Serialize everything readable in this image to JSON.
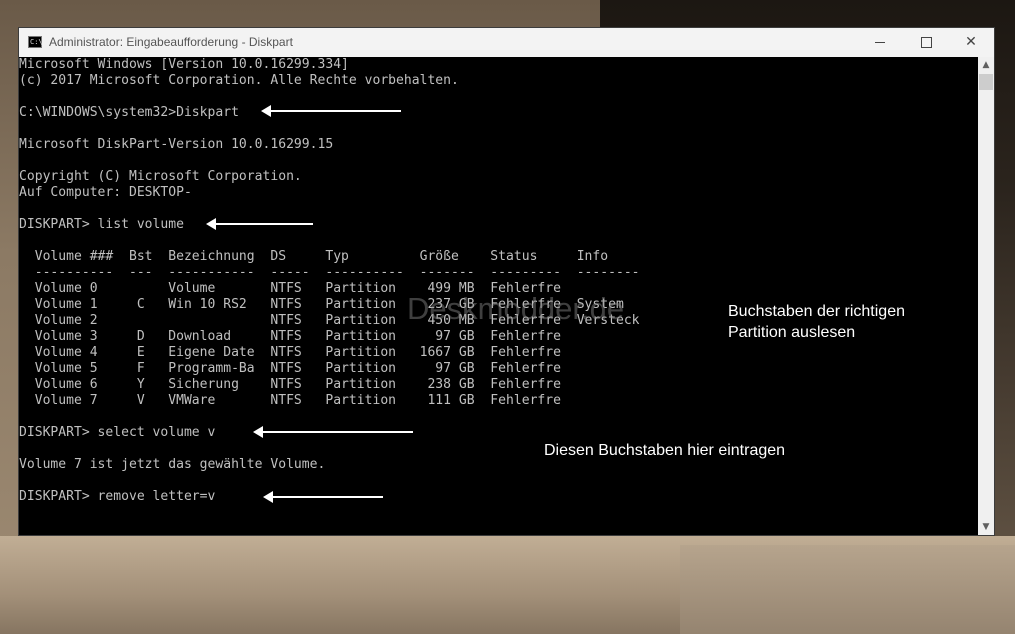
{
  "window": {
    "title": "Administrator: Eingabeaufforderung - Diskpart",
    "icon_text": "C:\\",
    "controls": {
      "minimize": "minimize-icon",
      "maximize": "maximize-icon",
      "close": "close-icon",
      "close_glyph": "✕"
    }
  },
  "console": {
    "lines": [
      "Microsoft Windows [Version 10.0.16299.334]",
      "(c) 2017 Microsoft Corporation. Alle Rechte vorbehalten.",
      "",
      "C:\\WINDOWS\\system32>Diskpart",
      "",
      "Microsoft DiskPart-Version 10.0.16299.15",
      "",
      "Copyright (C) Microsoft Corporation.",
      "Auf Computer: DESKTOP-",
      "",
      "DISKPART> list volume",
      "",
      "  Volume ###  Bst  Bezeichnung  DS     Typ         Größe    Status     Info",
      "  ----------  ---  -----------  -----  ----------  -------  ---------  --------",
      "  Volume 0         Volume       NTFS   Partition    499 MB  Fehlerfre",
      "  Volume 1     C   Win 10 RS2   NTFS   Partition    237 GB  Fehlerfre  System",
      "  Volume 2                      NTFS   Partition    450 MB  Fehlerfre  Versteck",
      "  Volume 3     D   Download     NTFS   Partition     97 GB  Fehlerfre",
      "  Volume 4     E   Eigene Date  NTFS   Partition   1667 GB  Fehlerfre",
      "  Volume 5     F   Programm-Ba  NTFS   Partition     97 GB  Fehlerfre",
      "  Volume 6     Y   Sicherung    NTFS   Partition    238 GB  Fehlerfre",
      "  Volume 7     V   VMWare       NTFS   Partition    111 GB  Fehlerfre",
      "",
      "DISKPART> select volume v",
      "",
      "Volume 7 ist jetzt das gewählte Volume.",
      "",
      "DISKPART> remove letter=v"
    ]
  },
  "annotations": {
    "note_partition": [
      "Buchstaben der richtigen",
      "Partition auslesen"
    ],
    "note_letter": "Diesen Buchstaben hier eintragen",
    "watermark": "Deskmodder.de"
  },
  "scrollbar": {
    "up_glyph": "▲",
    "down_glyph": "▼"
  }
}
